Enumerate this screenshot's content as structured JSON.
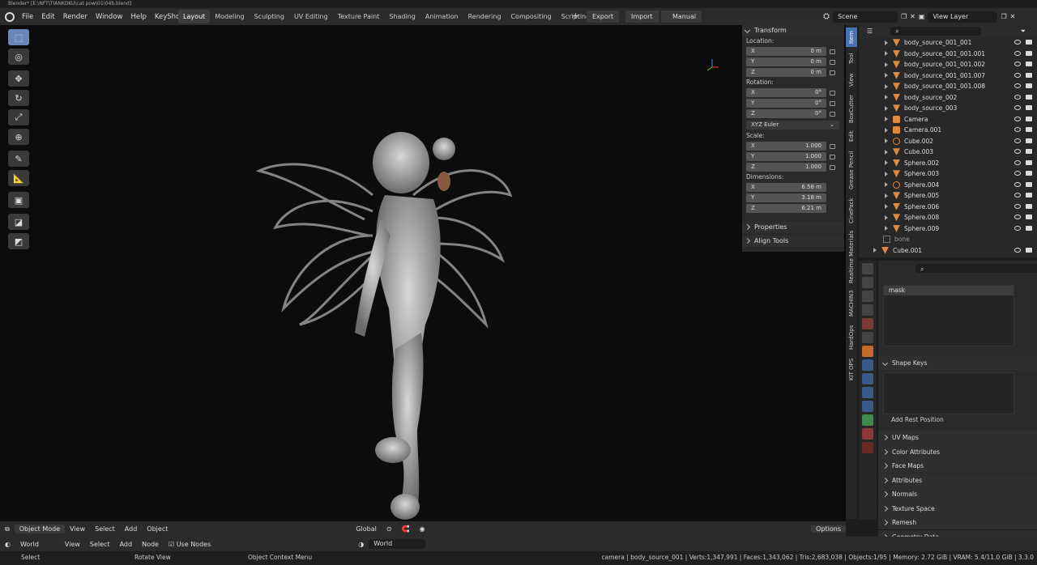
{
  "window": {
    "title": "Blender* [E:\\NFT\\TIANKOKU\\cat pow\\01\\04b.blend]"
  },
  "menu": [
    "File",
    "Edit",
    "Render",
    "Window",
    "Help",
    "KeyShot"
  ],
  "workspaces": [
    "Layout",
    "Modeling",
    "Sculpting",
    "UV Editing",
    "Texture Paint",
    "Shading",
    "Animation",
    "Rendering",
    "Compositing",
    "Scripting"
  ],
  "topbar_buttons": {
    "export": "Export",
    "import": "Import",
    "manual": "Manual"
  },
  "scene": {
    "name": "Scene",
    "view_layer": "View Layer"
  },
  "transform": {
    "header": "Transform",
    "location_label": "Location:",
    "location": [
      {
        "axis": "X",
        "value": "0 m"
      },
      {
        "axis": "Y",
        "value": "0 m"
      },
      {
        "axis": "Z",
        "value": "0 m"
      }
    ],
    "rotation_label": "Rotation:",
    "rotation": [
      {
        "axis": "X",
        "value": "0°"
      },
      {
        "axis": "Y",
        "value": "0°"
      },
      {
        "axis": "Z",
        "value": "0°"
      }
    ],
    "rotation_mode": "XYZ Euler",
    "scale_label": "Scale:",
    "scale": [
      {
        "axis": "X",
        "value": "1.000"
      },
      {
        "axis": "Y",
        "value": "1.000"
      },
      {
        "axis": "Z",
        "value": "1.000"
      }
    ],
    "dimensions_label": "Dimensions:",
    "dimensions": [
      {
        "axis": "X",
        "value": "6.58 m"
      },
      {
        "axis": "Y",
        "value": "3.18 m"
      },
      {
        "axis": "Z",
        "value": "6.21 m"
      }
    ]
  },
  "npanel_sections": {
    "properties": "Properties",
    "align_tools": "Align Tools"
  },
  "vertical_tabs": [
    "Item",
    "Tool",
    "View",
    "BoxCutter",
    "Edit",
    "Grease Pencil",
    "CinePack",
    "Realtime Materials",
    "MACHIN3",
    "HardOps",
    "KIT OPS"
  ],
  "outliner": [
    {
      "name": "body_source_001_001",
      "type": "mesh"
    },
    {
      "name": "body_source_001_001.001",
      "type": "mesh"
    },
    {
      "name": "body_source_001_001.002",
      "type": "mesh"
    },
    {
      "name": "body_source_001_001.007",
      "type": "mesh"
    },
    {
      "name": "body_source_001_001.008",
      "type": "mesh"
    },
    {
      "name": "body_source_002",
      "type": "mesh"
    },
    {
      "name": "body_source_003",
      "type": "mesh"
    },
    {
      "name": "Camera",
      "type": "camera"
    },
    {
      "name": "Camera.001",
      "type": "camera"
    },
    {
      "name": "Cube.002",
      "type": "curve"
    },
    {
      "name": "Cube.003",
      "type": "mesh"
    },
    {
      "name": "Sphere.002",
      "type": "mesh"
    },
    {
      "name": "Sphere.003",
      "type": "mesh"
    },
    {
      "name": "Sphere.004",
      "type": "curve"
    },
    {
      "name": "Sphere.005",
      "type": "mesh"
    },
    {
      "name": "Sphere.006",
      "type": "mesh"
    },
    {
      "name": "Sphere.008",
      "type": "mesh"
    },
    {
      "name": "Sphere.009",
      "type": "mesh"
    }
  ],
  "outliner_bone": "bone",
  "outliner_cube": "Cube.001",
  "props": {
    "vertex_group": "mask",
    "shape_keys": "Shape Keys",
    "add_rest_position": "Add Rest Position",
    "sections": [
      "UV Maps",
      "Color Attributes",
      "Face Maps",
      "Attributes",
      "Normals",
      "Texture Space",
      "Remesh",
      "Geometry Data"
    ]
  },
  "viewport_header": {
    "mode": "Object Mode",
    "view": "View",
    "select": "Select",
    "add": "Add",
    "object": "Object",
    "orientation": "Global",
    "options": "Options"
  },
  "shader_header": {
    "world": "World",
    "view": "View",
    "select": "Select",
    "add": "Add",
    "node": "Node",
    "use_nodes": "Use Nodes",
    "world_name": "World"
  },
  "status": {
    "select": "Select",
    "rotate": "Rotate View",
    "context": "Object Context Menu",
    "info": "camera | body_source_001 | Verts:1,347,991 | Faces:1,343,062 | Tris:2,683,038 | Objects:1/95 | Memory: 2.72 GiB | VRAM: 5.4/11.0 GiB | 3.3.0"
  }
}
